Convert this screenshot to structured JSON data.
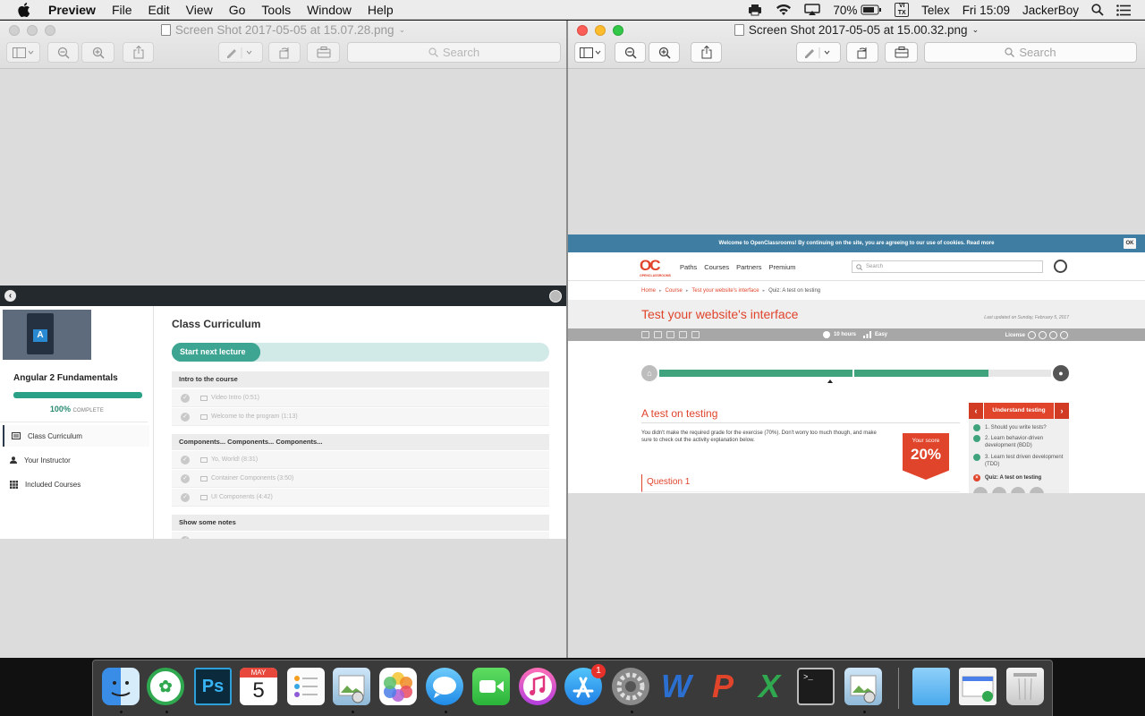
{
  "menubar": {
    "app_name": "Preview",
    "menus": [
      "File",
      "Edit",
      "View",
      "Go",
      "Tools",
      "Window",
      "Help"
    ],
    "battery": "70%",
    "input_badge": [
      "VI",
      "TX"
    ],
    "input_source": "Telex",
    "clock": "Fri 15:09",
    "user": "JackerBoy"
  },
  "left_window": {
    "title": "Screen Shot 2017-05-05 at 15.07.28.png",
    "search_placeholder": "Search",
    "course": {
      "title": "Angular 2 Fundamentals",
      "progress_pct": 100,
      "progress_label": "100%",
      "progress_suffix": "COMPLETE",
      "nav": [
        "Class Curriculum",
        "Your Instructor",
        "Included Courses"
      ],
      "heading": "Class Curriculum",
      "cta": "Start next lecture",
      "sections": [
        {
          "title": "Intro to the course",
          "lectures": [
            "Video Intro (0:51)",
            "Welcome to the program (1:13)"
          ]
        },
        {
          "title": "Components... Components... Components...",
          "lectures": [
            "Yo, World! (8:31)",
            "Container Components (3:50)",
            "UI Components (4:42)"
          ]
        },
        {
          "title": "Show some notes",
          "lectures": []
        }
      ]
    }
  },
  "right_window": {
    "title": "Screen Shot 2017-05-05 at 15.00.32.png",
    "search_placeholder": "Search",
    "oc": {
      "cookie_text": "Welcome to OpenClassrooms! By continuing on the site, you are agreeing to our use of cookies. Read more",
      "cookie_ok": "OK",
      "logo_text": "OC",
      "logo_sub": "OPENCLASSROOMS",
      "nav": [
        "Paths",
        "Courses",
        "Partners",
        "Premium"
      ],
      "search_placeholder": "Search",
      "breadcrumb": [
        "Home",
        "Course",
        "Test your website's interface"
      ],
      "breadcrumb_current": "Quiz: A test on testing",
      "course_title": "Test your website's interface",
      "updated": "Last updated on Sunday, February 5, 2017",
      "duration": "10 hours",
      "difficulty": "Easy",
      "license": "License",
      "course_progress_pct": 84,
      "quiz_title": "A test on testing",
      "quiz_text": "You didn't make the required grade for the exercise (70%). Don't worry too much though, and make sure to check out the activity explanation below.",
      "score_label": "Your score",
      "score_value": "20%",
      "question": "Question 1",
      "chapter": "Understand testing",
      "items": [
        "1. Should you write tests?",
        "2. Learn behavior-driven development (BDD)",
        "3. Learn test driven development (TDD)"
      ],
      "current_item": "Quiz: A test on testing"
    }
  },
  "dock": {
    "items": [
      "Finder",
      "Coc Coc",
      "Photoshop",
      "Calendar",
      "Reminders",
      "Preview",
      "Photos",
      "Messages",
      "FaceTime",
      "iTunes",
      "App Store",
      "System Preferences",
      "Word",
      "PowerPoint",
      "Excel",
      "Terminal",
      "Preview",
      "Downloads",
      "Applications",
      "Trash"
    ],
    "calendar_month": "MAY",
    "calendar_day": "5",
    "app_store_badge": "1",
    "photoshop_label": "Ps"
  },
  "colors": {
    "oc_red": "#e0442b",
    "teal": "#3fa593",
    "cookie_blue": "#3f7ea2",
    "progress_green": "#3fa47d"
  }
}
